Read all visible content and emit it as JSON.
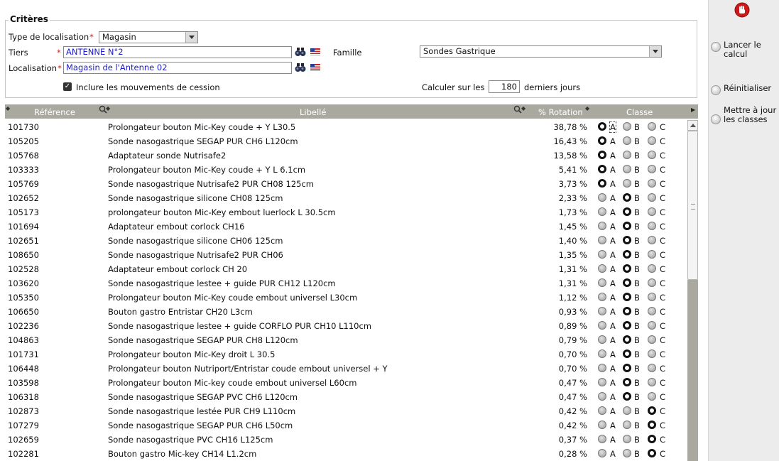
{
  "criteria": {
    "legend": "Critères",
    "type_label": "Type de localisation",
    "type_value": "Magasin",
    "tiers_label": "Tiers",
    "tiers_value": "ANTENNE N°2",
    "loc_label": "Localisation",
    "loc_value": "Magasin de l'Antenne 02",
    "famille_label": "Famille",
    "famille_value": "Sondes Gastrique",
    "include_label": "Inclure les mouvements de cession",
    "include_checked": true,
    "calc_label": "Calculer sur les",
    "days_value": "180",
    "days_suffix": "derniers jours",
    "required_mark": "*"
  },
  "grid": {
    "headers": {
      "reference": "Référence",
      "libelle": "Libellé",
      "rotation": "% Rotation",
      "classe": "Classe"
    },
    "class_labels": [
      "A",
      "B",
      "C"
    ],
    "rows": [
      {
        "ref": "101730",
        "lib": "Prolongateur  bouton Mic-Key  coude + Y L30.5",
        "rot": "38,78 %",
        "cls": "A"
      },
      {
        "ref": "105205",
        "lib": "Sonde nasogastrique SEGAP PUR CH6 L120cm",
        "rot": "16,43 %",
        "cls": "A"
      },
      {
        "ref": "105768",
        "lib": "Adaptateur sonde Nutrisafe2",
        "rot": "13,58 %",
        "cls": "A"
      },
      {
        "ref": "103333",
        "lib": "Prolongateur  bouton Mic-Key  coude + Y L 6.1cm",
        "rot": "5,41 %",
        "cls": "A"
      },
      {
        "ref": "105769",
        "lib": "Sonde nasogastrique Nutrisafe2 PUR CH08 125cm",
        "rot": "3,73 %",
        "cls": "A"
      },
      {
        "ref": "102652",
        "lib": "Sonde nasogastrique silicone CH08 125cm",
        "rot": "2,33 %",
        "cls": "B"
      },
      {
        "ref": "105173",
        "lib": "prolongateur bouton Mic-Key embout luerlock L 30.5cm",
        "rot": "1,73 %",
        "cls": "B"
      },
      {
        "ref": "101694",
        "lib": "Adaptateur embout corlock CH16",
        "rot": "1,45 %",
        "cls": "B"
      },
      {
        "ref": "102651",
        "lib": "Sonde nasogastrique silicone CH06 125cm",
        "rot": "1,40 %",
        "cls": "B"
      },
      {
        "ref": "108650",
        "lib": "Sonde nasogastrique Nutrisafe2 PUR CH06",
        "rot": "1,35 %",
        "cls": "B"
      },
      {
        "ref": "102528",
        "lib": "Adaptateur embout corlock CH 20",
        "rot": "1,31 %",
        "cls": "B"
      },
      {
        "ref": "103620",
        "lib": "Sonde nasogastrique lestee + guide PUR CH12 L120cm",
        "rot": "1,31 %",
        "cls": "B"
      },
      {
        "ref": "105350",
        "lib": "Prolongateur bouton Mic-Key coude embout universel L30cm",
        "rot": "1,12 %",
        "cls": "B"
      },
      {
        "ref": "106650",
        "lib": "Bouton gastro Entristar CH20 L3cm",
        "rot": "0,93 %",
        "cls": "B"
      },
      {
        "ref": "102236",
        "lib": "Sonde nasogastrique lestee + guide CORFLO PUR CH10 L110cm",
        "rot": "0,89 %",
        "cls": "B"
      },
      {
        "ref": "104863",
        "lib": "Sonde nasogastrique SEGAP PUR CH8 L120cm",
        "rot": "0,79 %",
        "cls": "B"
      },
      {
        "ref": "101731",
        "lib": "Prolongateur bouton Mic-Key droit L 30.5",
        "rot": "0,70 %",
        "cls": "B"
      },
      {
        "ref": "106448",
        "lib": "Prolongateur bouton Nutriport/Entristar coude embout universel + Y",
        "rot": "0,70 %",
        "cls": "B"
      },
      {
        "ref": "103598",
        "lib": "Prolongateur bouton Mic-key coude embout universel L60cm",
        "rot": "0,47 %",
        "cls": "B"
      },
      {
        "ref": "106318",
        "lib": "Sonde nasogastrique SEGAP PVC CH6 L120cm",
        "rot": "0,47 %",
        "cls": "B"
      },
      {
        "ref": "102873",
        "lib": "Sonde nasogastrique lestée PUR CH9 L110cm",
        "rot": "0,42 %",
        "cls": "C"
      },
      {
        "ref": "107279",
        "lib": "Sonde nasogastrique SEGAP PUR CH6 L50cm",
        "rot": "0,42 %",
        "cls": "C"
      },
      {
        "ref": "102659",
        "lib": "Sonde nasogastrique PVC CH16 L125cm",
        "rot": "0,37 %",
        "cls": "C"
      },
      {
        "ref": "102281",
        "lib": "Bouton gastro Mic-key  CH14 L1.2cm",
        "rot": "0,28 %",
        "cls": "C"
      }
    ]
  },
  "side": {
    "launch": "Lancer le calcul",
    "reset": "Réinitialiser",
    "update": "Mettre à jour les classes"
  },
  "colors": {
    "header_bg": "#aaa9a0",
    "input_text": "#1c1ccc",
    "required": "#cc2020",
    "stop": "#cc1a1a"
  }
}
